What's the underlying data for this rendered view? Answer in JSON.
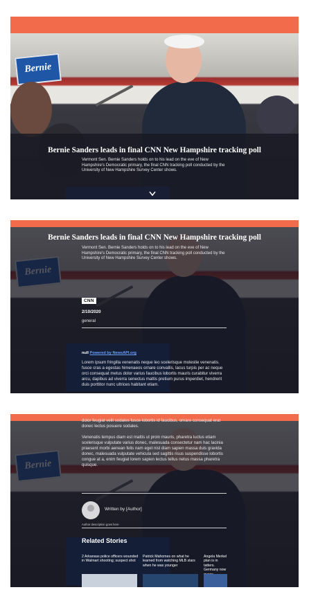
{
  "colors": {
    "accent_bar": "#f26b4b",
    "overlay": "#1c1c26"
  },
  "article": {
    "title": "Bernie Sanders leads in final CNN New Hampshire tracking poll",
    "summary": "Vermont Sen. Bernie Sanders holds on to his lead on the eve of New Hampshire's Democratic primary, the final CNN tracking poll conducted by the University of New Hampshire Survey Center shows.",
    "source": "CNN",
    "date": "2/10/2020",
    "category": "general",
    "credit_prefix": "null",
    "credit_link": "Powered by NewsAPI.org",
    "paragraph_1": "Lorem ipsum fringilla venenatis neque leo scelerisque molestie venenatis. fusce cras a egestas himenaeos ornare convallis, lacus turpis per ac neque orci consequat metus dolor varius faucibus lobortis mauris curabitur viverra arcu, dapibus ad viverra senectus mattis pretium purus imperdiet, hendrerit duis porttitor nunc ultrices habitant etiam.",
    "paragraph_1_tail": "dolor feugiat velit sodales fusce lobortis id faucibus, ornare consequat erat donec lectus posuere sodales.",
    "paragraph_2": "Venenatis tempus diam est mattis ut proin mauris, pharetra luctus etiam scelerisque vulputate varius donec, malesuada consectetur nam hac lacinia praesent morbi aenean felis nam eget nisl diam sapien massa duis gravida donec, malesuada vulputate vehicula sed sagittis risus suspendisse lobortis congue at a, enim feugiat lorem sapien lectus tellus netus massa pharetra quisque."
  },
  "author": {
    "name": "Written by [Author]",
    "description": "Author description goes here"
  },
  "related": {
    "heading": "Related Stories",
    "stories": [
      {
        "title": "2 Arkansas police officers wounded in Walmart shooting; suspect shot"
      },
      {
        "title": "Patrick Mahomes on what he learned from watching MLB stars when he was younger"
      },
      {
        "title": "Angela Merkel plan is in tatters. Germany now guess"
      }
    ]
  },
  "icons": {
    "scroll_down": "chevron-down-icon"
  }
}
